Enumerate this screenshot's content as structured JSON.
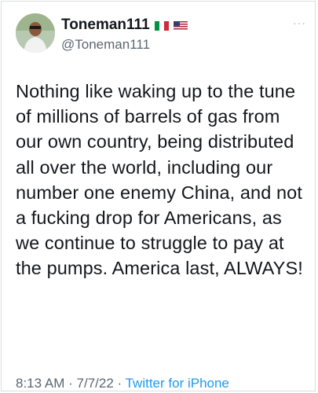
{
  "user": {
    "display_name": "Toneman111",
    "handle": "@Toneman111",
    "flags": [
      "italy-flag-icon",
      "usa-flag-icon"
    ]
  },
  "tweet": {
    "text": "Nothing like waking up to the tune of millions of barrels of gas from our own country, being distributed all over the world, including our number one enemy China, and not a fucking drop for Americans, as we continue to struggle to pay at the pumps. America last, ALWAYS!"
  },
  "meta": {
    "time": "8:13 AM",
    "separator": "·",
    "date": "7/7/22",
    "source": "Twitter for iPhone"
  },
  "more_label": "···",
  "colors": {
    "link": "#1d9bf0",
    "secondary": "#5b6772",
    "text": "#14171a"
  }
}
